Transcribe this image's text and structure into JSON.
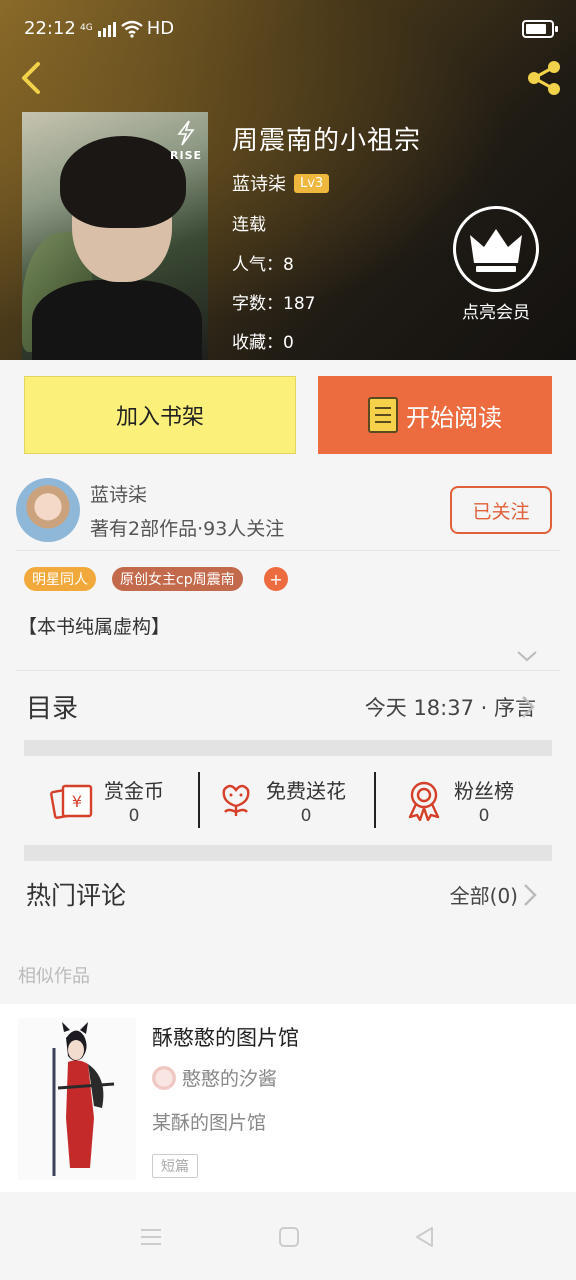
{
  "status_bar": {
    "time": "22:12",
    "network": "4G",
    "hd": "HD"
  },
  "book": {
    "title": "周震南的小祖宗",
    "cover_brand": "RISE",
    "author": "蓝诗柒",
    "author_level": "Lv3",
    "status": "连载",
    "popularity": "人气：8",
    "word_count": "字数：187",
    "favorites": "收藏：0"
  },
  "vip": {
    "label": "点亮会员"
  },
  "actions": {
    "add_shelf": "加入书架",
    "start_reading": "开始阅读"
  },
  "author_card": {
    "name": "蓝诗柒",
    "stats": "著有2部作品·93人关注",
    "follow_label": "已关注"
  },
  "tags": [
    "明星同人",
    "原创女主cp周震南"
  ],
  "tag_add": "+",
  "synopsis": "【本书纯属虚构】",
  "toc": {
    "label": "目录",
    "latest": "今天 18:37 · 序言"
  },
  "support": [
    {
      "label": "赏金币",
      "value": "0",
      "icon": "red-envelope-icon"
    },
    {
      "label": "免费送花",
      "value": "0",
      "icon": "flower-icon"
    },
    {
      "label": "粉丝榜",
      "value": "0",
      "icon": "ribbon-badge-icon"
    }
  ],
  "comments": {
    "label": "热门评论",
    "all_label": "全部(0)"
  },
  "similar": {
    "section_label": "相似作品",
    "items": [
      {
        "title": "酥憨憨的图片馆",
        "author": "憨憨的汐酱",
        "description": "某酥的图片馆",
        "tag": "短篇"
      }
    ]
  },
  "colors": {
    "accent": "#ec6b3f",
    "shelf_button": "#fbf07a",
    "level_badge": "#f0b73f",
    "tag_gold": "#f2a93b",
    "tag_brown": "#c46a4c"
  }
}
